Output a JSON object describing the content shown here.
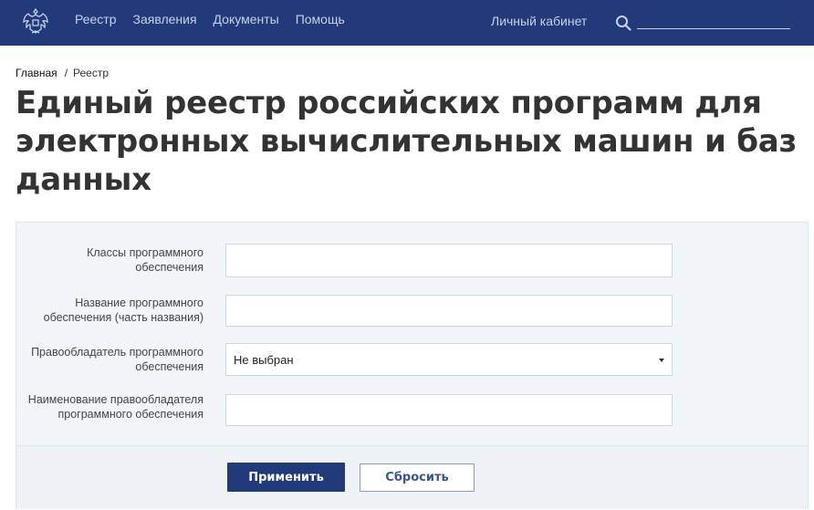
{
  "header": {
    "nav": [
      {
        "label": "Реестр"
      },
      {
        "label": "Заявления"
      },
      {
        "label": "Документы"
      },
      {
        "label": "Помощь"
      }
    ],
    "cabinet_label": "Личный кабинет",
    "search": {
      "value": "",
      "placeholder": ""
    },
    "colors": {
      "bar": "#22397a",
      "nav_text": "#c7d1ea"
    }
  },
  "breadcrumb": {
    "home": "Главная",
    "separator": "/",
    "current": "Реестр"
  },
  "page": {
    "title": "Единый реестр российских программ для электронных вычислительных машин и баз данных"
  },
  "filter": {
    "fields": [
      {
        "label": "Классы программного обеспечения",
        "type": "text",
        "value": ""
      },
      {
        "label": "Название программного обеспечения (часть названия)",
        "type": "text",
        "value": ""
      },
      {
        "label": "Правообладатель программного обеспечения",
        "type": "select",
        "value": "Не выбран"
      },
      {
        "label": "Наименование правообладателя программного обеспечения",
        "type": "text",
        "value": ""
      }
    ],
    "apply_label": "Применить",
    "reset_label": "Сбросить"
  }
}
